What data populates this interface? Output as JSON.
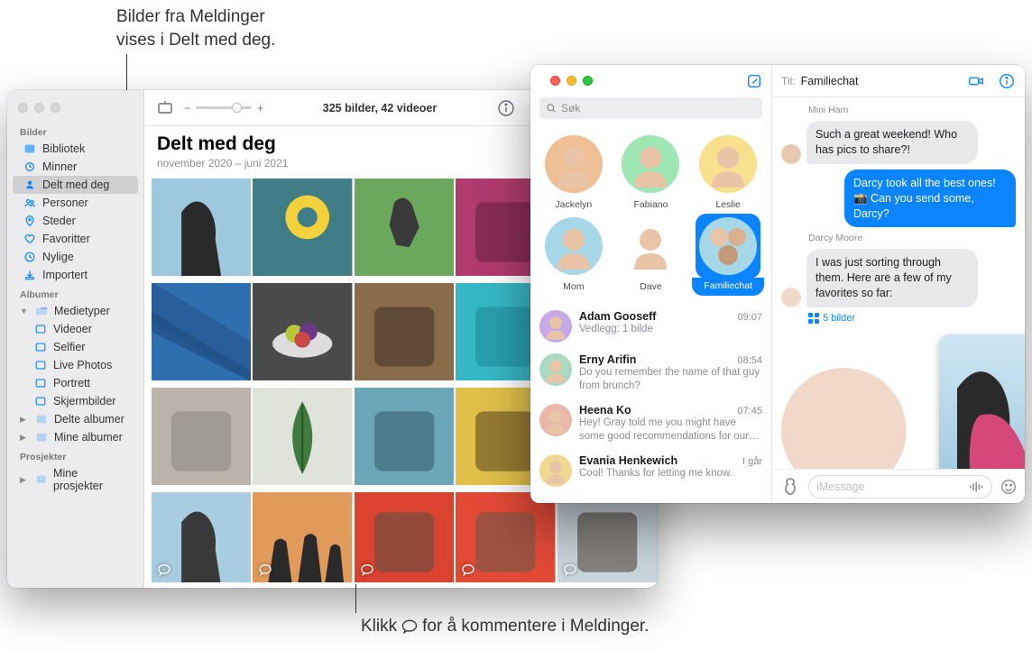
{
  "callouts": {
    "top": "Bilder fra Meldinger\nvises i Delt med deg.",
    "bottom_prefix": "Klikk ",
    "bottom_suffix": " for å kommentere i Meldinger."
  },
  "photos": {
    "sidebar": {
      "section_bilder": "Bilder",
      "items_main": [
        {
          "label": "Bibliotek",
          "icon": "library"
        },
        {
          "label": "Minner",
          "icon": "memories"
        },
        {
          "label": "Delt med deg",
          "icon": "shared",
          "selected": true
        },
        {
          "label": "Personer",
          "icon": "people"
        },
        {
          "label": "Steder",
          "icon": "places"
        },
        {
          "label": "Favoritter",
          "icon": "heart"
        },
        {
          "label": "Nylige",
          "icon": "clock"
        },
        {
          "label": "Importert",
          "icon": "import"
        }
      ],
      "section_albumer": "Albumer",
      "medietyper": "Medietyper",
      "items_media": [
        {
          "label": "Videoer"
        },
        {
          "label": "Selfier"
        },
        {
          "label": "Live Photos"
        },
        {
          "label": "Portrett"
        },
        {
          "label": "Skjermbilder"
        }
      ],
      "delte_albumer": "Delte albumer",
      "mine_albumer": "Mine albumer",
      "section_prosjekter": "Prosjekter",
      "mine_prosjekter": "Mine prosjekter"
    },
    "toolbar": {
      "minus": "−",
      "plus": "+",
      "counts": "325 bilder, 42 videoer"
    },
    "title": "Delt med deg",
    "subtitle": "november 2020 – juni 2021"
  },
  "messages": {
    "search_placeholder": "Søk",
    "pins": [
      {
        "name": "Jackelyn",
        "bg": "#efbf95",
        "ring": "#e07b63"
      },
      {
        "name": "Fabiano",
        "bg": "#9fe6b5",
        "ring": "#5fc784"
      },
      {
        "name": "Leslie",
        "bg": "#f9e08e",
        "ring": "#e9c557"
      },
      {
        "name": "Mom",
        "bg": "#a7d8e8",
        "ring": "#74bcd6"
      },
      {
        "name": "Dave",
        "bg": "#ffffff",
        "ring": "#d8d8d8"
      },
      {
        "name": "Familiechat",
        "bg": "#a7d8e8",
        "ring": "#0a84ff",
        "selected": true,
        "group": true
      }
    ],
    "conversations": [
      {
        "name": "Adam Gooseff",
        "time": "09:07",
        "preview": "Vedlegg: 1 bilde",
        "color": "#c7a9e8"
      },
      {
        "name": "Erny Arifin",
        "time": "08:54",
        "preview": "Do you remember the name of that guy from brunch?",
        "color": "#a9d9c2"
      },
      {
        "name": "Heena Ko",
        "time": "07:45",
        "preview": "Hey! Gray told me you might have some good recommendations for our…",
        "color": "#e8b8a9"
      },
      {
        "name": "Evania Henkewich",
        "time": "I går",
        "preview": "Cool! Thanks for letting me know.",
        "color": "#f0d890"
      }
    ],
    "header": {
      "to_label": "Til:",
      "to_name": "Familiechat"
    },
    "thread": {
      "s1": "Mini Ham",
      "m1": "Such a great weekend! Who has pics to share?!",
      "m2": "Darcy took all the best ones! 📸 Can you send some, Darcy?",
      "s3": "Darcy Moore",
      "m3": "I was just sorting through them. Here are a few of my favorites so far:",
      "attach": "5 bilder"
    },
    "composer": {
      "placeholder": "iMessage"
    }
  }
}
